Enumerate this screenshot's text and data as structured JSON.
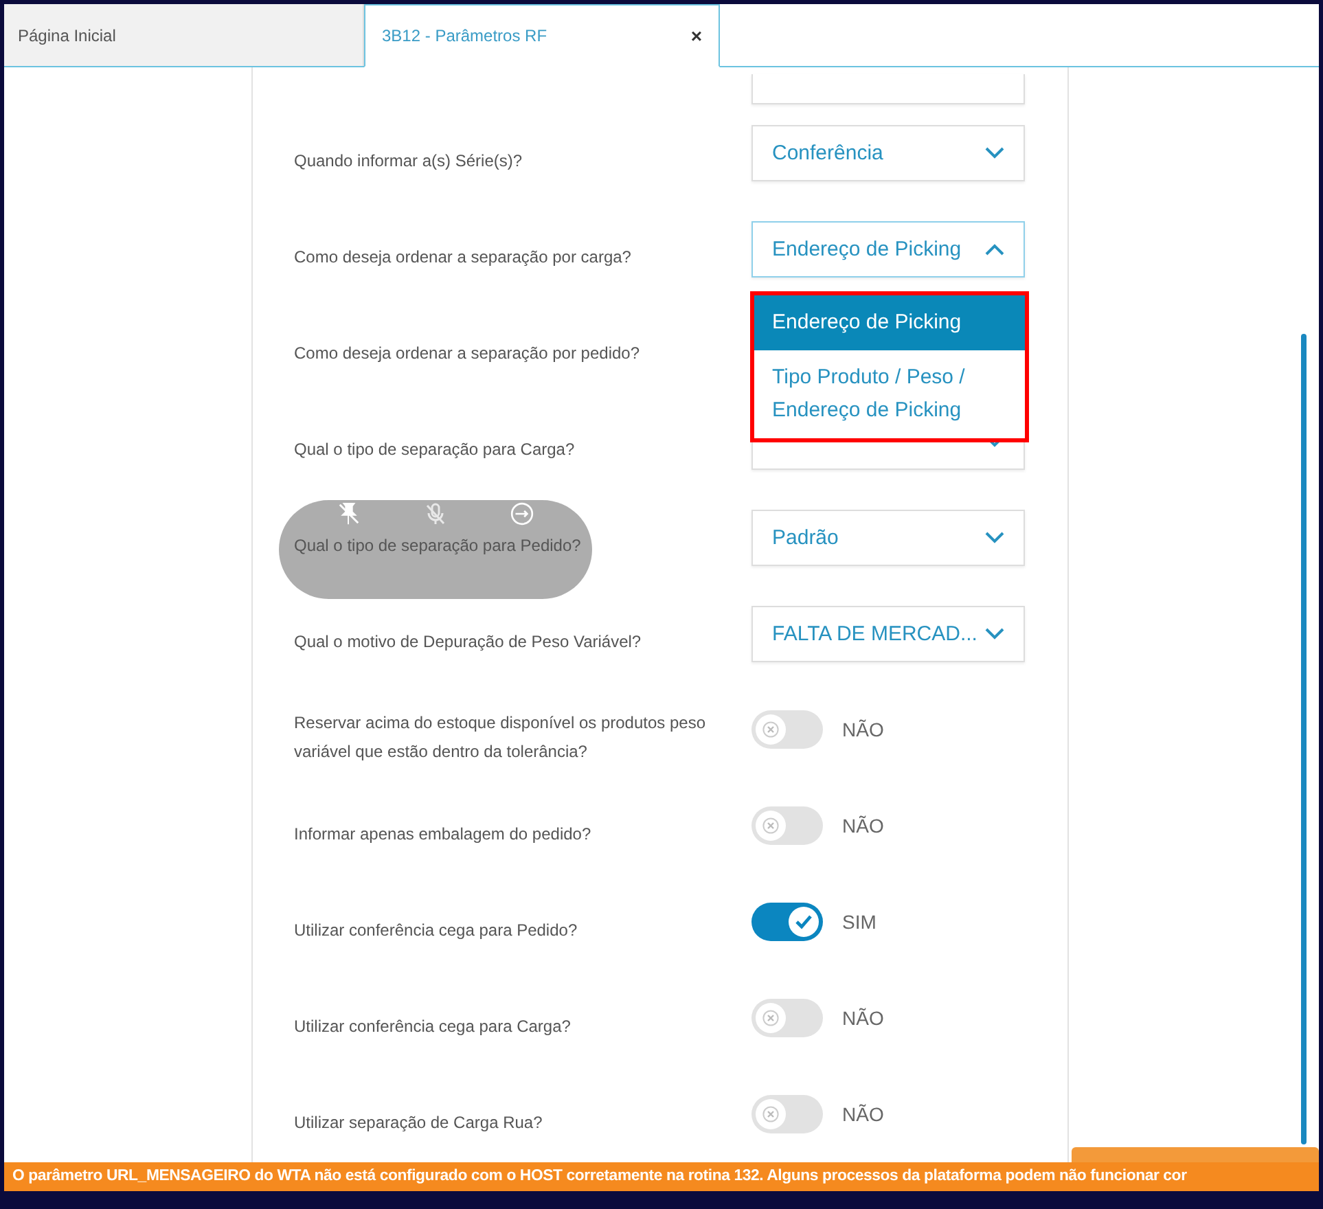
{
  "tabs": [
    {
      "label": "Página Inicial",
      "selected": false
    },
    {
      "label": "3B12 - Parâmetros RF",
      "selected": true,
      "close": "×"
    }
  ],
  "parameters": [
    {
      "kind": "select",
      "expanded": false
    },
    {
      "kind": "select",
      "label": "Quando informar a(s) Série(s)?",
      "value": "Conferência",
      "expanded": false
    },
    {
      "kind": "select",
      "label": "Como deseja ordenar a separação por carga?",
      "value": "Endereço de Picking",
      "expanded": true,
      "options": [
        {
          "label": "Endereço de Picking",
          "selected": true
        },
        {
          "label": "Tipo Produto / Peso / Endereço de Picking",
          "selected": false
        }
      ]
    },
    {
      "kind": "label",
      "label": "Como deseja ordenar a separação por pedido?"
    },
    {
      "kind": "select",
      "label": "Qual o tipo de separação para Carga?",
      "expanded": false
    },
    {
      "kind": "select",
      "label": "Qual o tipo de separação para Pedido?",
      "value": "Padrão",
      "expanded": false
    },
    {
      "kind": "select",
      "label": "Qual o motivo de Depuração de Peso Variável?",
      "value": "FALTA DE MERCAD...",
      "expanded": false
    },
    {
      "kind": "toggle",
      "label": "Reservar acima do estoque disponível os produtos peso variável que estão dentro da tolerância?",
      "on": false,
      "state_text": "NÃO"
    },
    {
      "kind": "toggle",
      "label": "Informar apenas embalagem do pedido?",
      "on": false,
      "state_text": "NÃO"
    },
    {
      "kind": "toggle",
      "label": "Utilizar conferência cega para Pedido?",
      "on": true,
      "state_text": "SIM"
    },
    {
      "kind": "toggle",
      "label": "Utilizar conferência cega para Carga?",
      "on": false,
      "state_text": "NÃO"
    },
    {
      "kind": "toggle",
      "label": "Utilizar separação de Carga Rua?",
      "on": false,
      "state_text": "NÃO"
    }
  ],
  "banner": {
    "text": "O parâmetro URL_MENSAGEIRO do WTA não está configurado com o HOST corretamente na rotina 132. Alguns processos da plataforma podem não funcionar cor"
  }
}
